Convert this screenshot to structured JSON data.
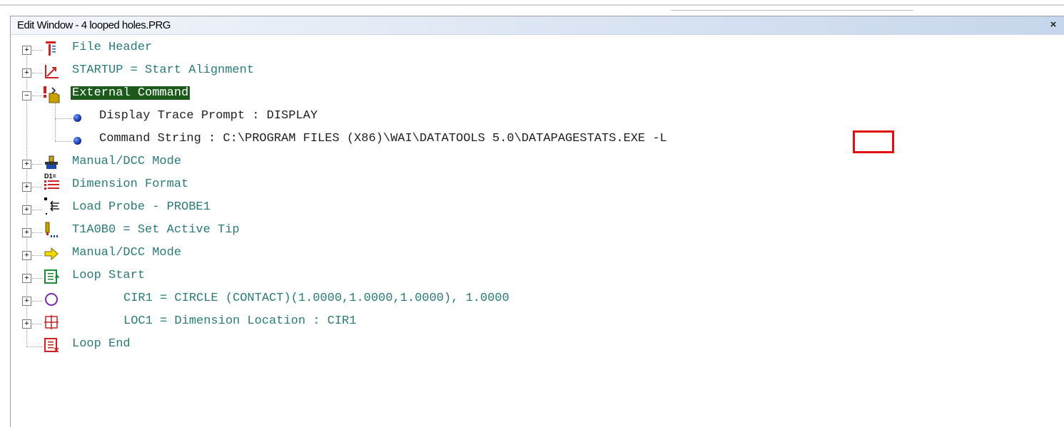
{
  "window": {
    "title": "Edit Window - 4 looped holes.PRG",
    "close_label": "×"
  },
  "tree": {
    "items": [
      {
        "label": "File Header",
        "icon": "file-header-icon",
        "expander": "+"
      },
      {
        "label": "STARTUP = Start Alignment",
        "icon": "alignment-icon",
        "expander": "+"
      },
      {
        "label": "External Command",
        "icon": "external-command-icon",
        "expander": "−",
        "selected": true,
        "children": [
          {
            "label": "Display Trace Prompt : DISPLAY",
            "icon": "bullet-icon"
          },
          {
            "label": "Command String : C:\\PROGRAM FILES (X86)\\WAI\\DATATOOLS 5.0\\DATAPAGESTATS.EXE ",
            "suffix": "-L",
            "icon": "bullet-icon"
          }
        ]
      },
      {
        "label": "Manual/DCC Mode",
        "icon": "manual-dcc-icon",
        "expander": "+"
      },
      {
        "label": "Dimension Format",
        "icon": "dimension-format-icon",
        "expander": "+"
      },
      {
        "label": "Load Probe - PROBE1",
        "icon": "load-probe-icon",
        "expander": "+"
      },
      {
        "label": "T1A0B0 = Set Active Tip",
        "icon": "active-tip-icon",
        "expander": "+"
      },
      {
        "label": "Manual/DCC Mode",
        "icon": "arrow-right-icon",
        "expander": "+"
      },
      {
        "label": "Loop Start",
        "icon": "loop-start-icon",
        "expander": "+"
      },
      {
        "label": "CIR1 = CIRCLE (CONTACT)(1.0000,1.0000,1.0000), 1.0000",
        "icon": "circle-icon",
        "expander": "+"
      },
      {
        "label": "LOC1 = Dimension Location : CIR1",
        "icon": "location-icon",
        "expander": "+"
      },
      {
        "label": "Loop End",
        "icon": "loop-end-icon"
      }
    ]
  },
  "colors": {
    "text": "#2a7a7a",
    "selected_bg": "#1c5a1c",
    "highlight": "#e01010"
  }
}
